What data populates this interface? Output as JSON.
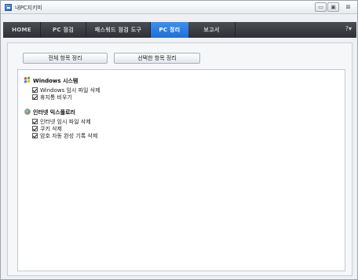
{
  "window": {
    "title": "내PC지키미",
    "controls": {
      "minimize": "▭",
      "maximize": "▣",
      "close": "⊠"
    }
  },
  "nav": {
    "tabs": [
      {
        "label": "HOME",
        "active": false
      },
      {
        "label": "PC 점검",
        "active": false
      },
      {
        "label": "패스워드 점검 도구",
        "active": false
      },
      {
        "label": "PC 정리",
        "active": true
      },
      {
        "label": "보고서",
        "active": false
      }
    ],
    "help": "?▾"
  },
  "actions": {
    "clean_all": "전체 항목 정리",
    "clean_selected": "선택한 항목 정리"
  },
  "groups": [
    {
      "title": "Windows 시스템",
      "icon": "windows-logo-icon",
      "items": [
        {
          "label": "Windows 임시 파일 삭제",
          "checked": true
        },
        {
          "label": "휴지통 비우기",
          "checked": true
        }
      ]
    },
    {
      "title": "인터넷 익스플로러",
      "icon": "internet-explorer-icon",
      "items": [
        {
          "label": "인터넷 임시 파일 삭제",
          "checked": true
        },
        {
          "label": "쿠키 삭제",
          "checked": true
        },
        {
          "label": "암호 자동 완성 기록 삭제",
          "checked": true
        }
      ]
    }
  ],
  "colors": {
    "nav_active": "#2a7fe3",
    "nav_bg": "#3a3d42"
  }
}
